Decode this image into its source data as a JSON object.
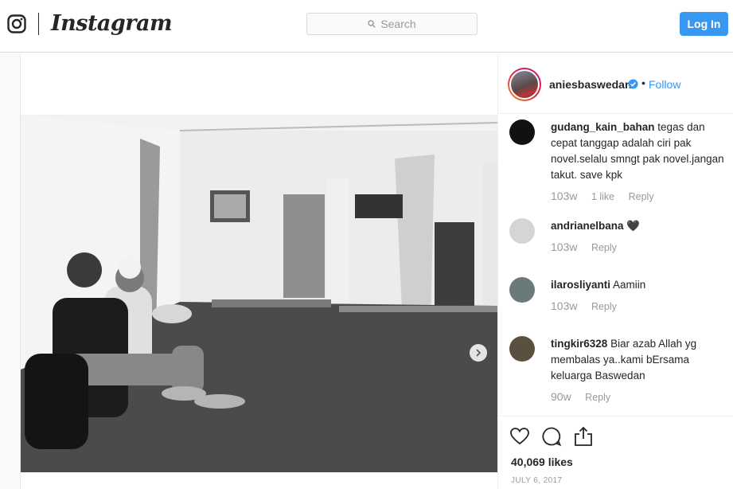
{
  "header": {
    "brand": "Instagram",
    "search_placeholder": "Search",
    "login_label": "Log In"
  },
  "post": {
    "username": "aniesbaswedan",
    "follow_label": "Follow",
    "separator": "•",
    "likes": "40,069 likes",
    "date": "JULY 6, 2017"
  },
  "comments": [
    {
      "user": "gudang_kain_bahan",
      "text": "tegas dan cepat tanggap adalah ciri pak novel.selalu smngt pak novel.jangan takut. save kpk",
      "ago": "103w",
      "likes": "1 like",
      "reply": "Reply"
    },
    {
      "user": "andrianelbana",
      "text": "🖤",
      "ago": "103w",
      "likes": "",
      "reply": "Reply"
    },
    {
      "user": "ilarosliyanti",
      "text": "Aamiin",
      "ago": "103w",
      "likes": "",
      "reply": "Reply"
    },
    {
      "user": "tingkir6328",
      "text": "Biar azab Allah yg membalas ya..kami bErsama keluarga Baswedan",
      "ago": "90w",
      "likes": "",
      "reply": "Reply"
    }
  ],
  "icons": [
    "instagram-glyph-icon",
    "search-icon",
    "verified-badge-icon",
    "chevron-right-icon",
    "heart-icon",
    "comment-icon",
    "share-icon"
  ],
  "colors": {
    "accent": "#3897f0",
    "border": "#dbdbdb",
    "muted": "#999999"
  }
}
